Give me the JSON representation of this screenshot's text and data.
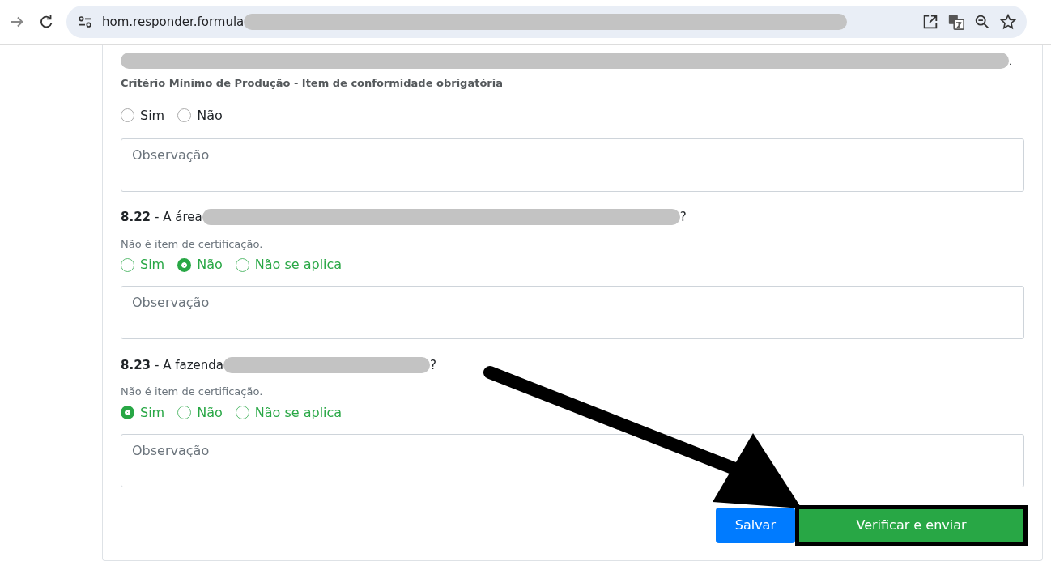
{
  "browser": {
    "url": "hom.responder.formula"
  },
  "questions": [
    {
      "kind": "mandatory",
      "suffix": ".",
      "note": "Critério Mínimo de Produção - Item de conformidade obrigatória",
      "options": [
        {
          "label": "Sim",
          "selected": false
        },
        {
          "label": "Não",
          "selected": false
        }
      ],
      "placeholder": "Observação"
    },
    {
      "kind": "optional",
      "number": "8.22",
      "text": "- A área",
      "suffix": "?",
      "note": "Não é item de certificação.",
      "options": [
        {
          "label": "Sim",
          "selected": false
        },
        {
          "label": "Não",
          "selected": true
        },
        {
          "label": "Não se aplica",
          "selected": false
        }
      ],
      "placeholder": "Observação"
    },
    {
      "kind": "optional",
      "number": "8.23",
      "text": "- A fazenda",
      "suffix": "?",
      "note": "Não é item de certificação.",
      "options": [
        {
          "label": "Sim",
          "selected": true
        },
        {
          "label": "Não",
          "selected": false
        },
        {
          "label": "Não se aplica",
          "selected": false
        }
      ],
      "placeholder": "Observação"
    }
  ],
  "buttons": [
    {
      "kind": "save",
      "label": "Salvar"
    },
    {
      "kind": "submit",
      "label": "Verificar e enviar",
      "highlighted": true
    }
  ]
}
